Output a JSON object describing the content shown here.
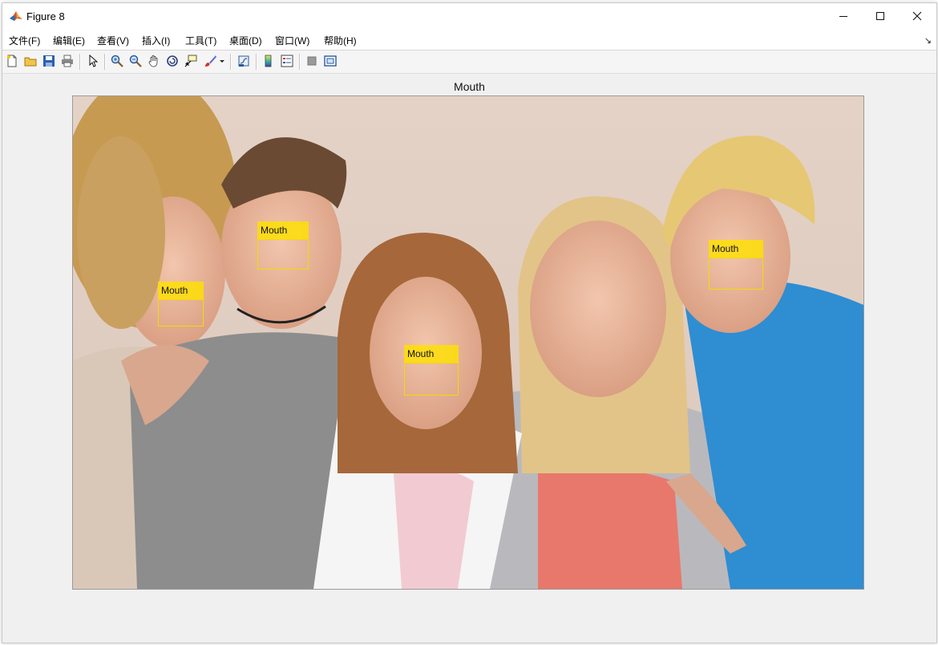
{
  "window": {
    "title": "Figure 8",
    "icon": "matlab-logo-icon",
    "controls": [
      "minimize-icon",
      "maximize-icon",
      "close-icon"
    ]
  },
  "menu": [
    {
      "label": "文件(F)"
    },
    {
      "label": "编辑(E)"
    },
    {
      "label": "查看(V)"
    },
    {
      "label": "插入(I)"
    },
    {
      "label": "工具(T)"
    },
    {
      "label": "桌面(D)"
    },
    {
      "label": "窗口(W)"
    },
    {
      "label": "帮助(H)"
    }
  ],
  "toolbar": [
    "new-figure-icon",
    "open-file-icon",
    "save-icon",
    "print-icon",
    "pointer-icon",
    "zoom-in-icon",
    "zoom-out-icon",
    "pan-hand-icon",
    "rotate-3d-icon",
    "data-cursor-icon",
    "brush-icon",
    "link-plot-icon",
    "colorbar-icon",
    "legend-icon",
    "hide-plot-tools-icon",
    "show-plot-tools-icon"
  ],
  "axes": {
    "title": "Mouth"
  },
  "detections": [
    {
      "label": "Mouth"
    },
    {
      "label": "Mouth"
    },
    {
      "label": "Mouth"
    },
    {
      "label": "Mouth"
    }
  ],
  "colors": {
    "detection": "#ffe100",
    "box_border": "#f2dc00",
    "window_bg": "#f0f0f0"
  }
}
